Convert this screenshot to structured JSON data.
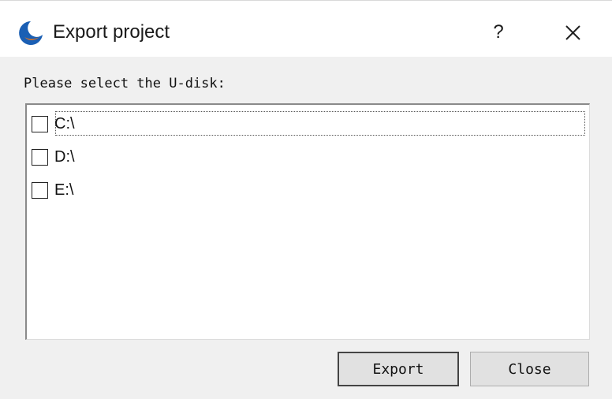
{
  "window": {
    "title": "Export project",
    "help_label": "?",
    "icon": "moon-logo-icon",
    "accent_color": "#1a5fb4"
  },
  "prompt": "Please select the U-disk:",
  "drives": [
    {
      "label": "C:\\",
      "checked": false,
      "focused": true
    },
    {
      "label": "D:\\",
      "checked": false,
      "focused": false
    },
    {
      "label": "E:\\",
      "checked": false,
      "focused": false
    }
  ],
  "buttons": {
    "export_label": "Export",
    "close_label": "Close"
  }
}
